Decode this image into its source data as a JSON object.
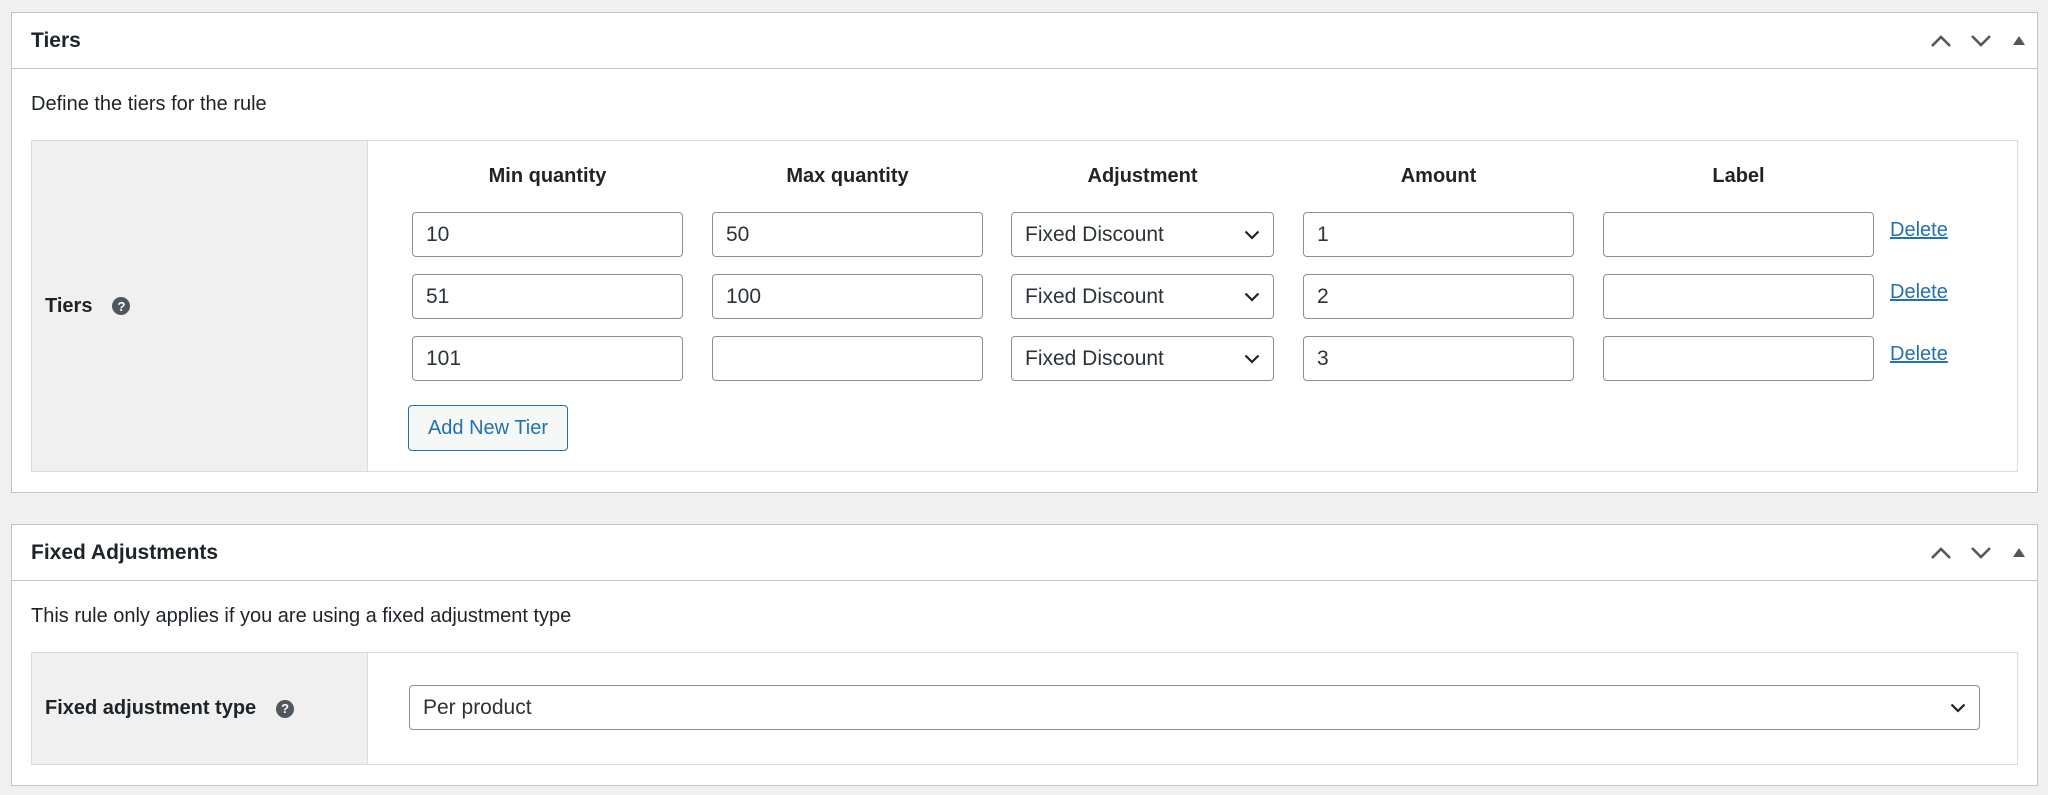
{
  "tiers_box": {
    "title": "Tiers",
    "description": "Define the tiers for the rule",
    "field_label": "Tiers",
    "help_icon": "?",
    "columns": [
      "Min quantity",
      "Max quantity",
      "Adjustment",
      "Amount",
      "Label"
    ],
    "rows": [
      {
        "min": "10",
        "max": "50",
        "adjustment": "Fixed Discount",
        "amount": "1",
        "label": "",
        "delete": "Delete"
      },
      {
        "min": "51",
        "max": "100",
        "adjustment": "Fixed Discount",
        "amount": "2",
        "label": "",
        "delete": "Delete"
      },
      {
        "min": "101",
        "max": "",
        "adjustment": "Fixed Discount",
        "amount": "3",
        "label": "",
        "delete": "Delete"
      }
    ],
    "add_button": "Add New Tier"
  },
  "fixed_box": {
    "title": "Fixed Adjustments",
    "description": "This rule only applies if you are using a fixed adjustment type",
    "field_label": "Fixed adjustment type",
    "help_icon": "?",
    "select_value": "Per product"
  },
  "icons": {
    "move_up": "chevron-up-icon",
    "move_down": "chevron-down-icon",
    "toggle": "triangle-up-icon",
    "help": "question-circle-icon",
    "dropdown": "chevron-down-icon"
  },
  "colors": {
    "background": "#f0f0f1",
    "link": "#2271b1",
    "border": "#c3c4c7",
    "text": "#1d2327"
  }
}
